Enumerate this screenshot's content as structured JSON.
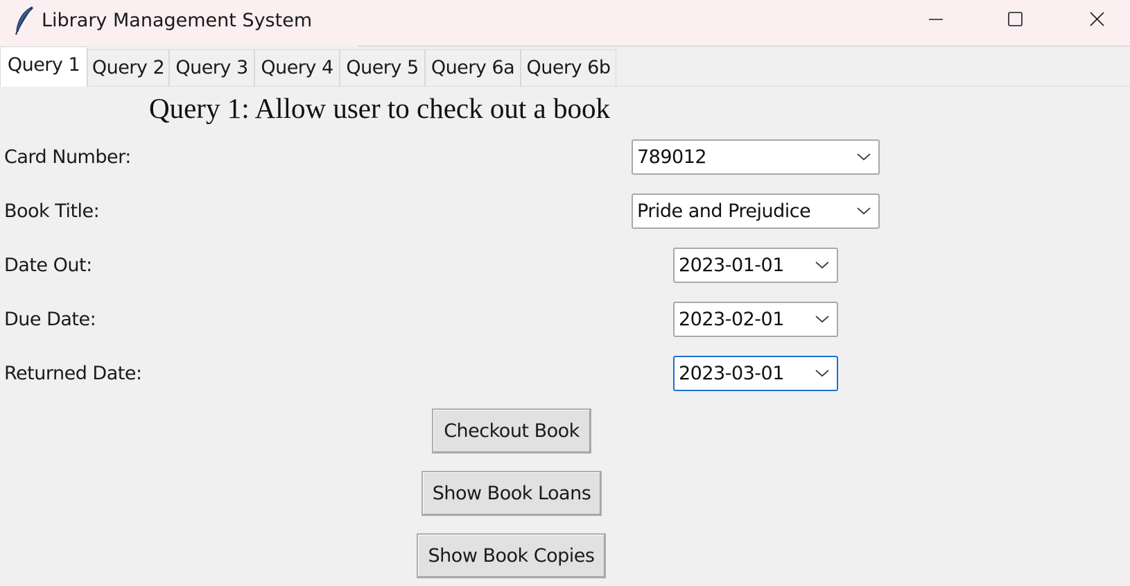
{
  "window": {
    "title": "Library Management System",
    "icon": "feather-icon",
    "controls": [
      "minimize-icon",
      "maximize-icon",
      "close-icon"
    ]
  },
  "tabs": [
    {
      "label": "Query 1",
      "active": true
    },
    {
      "label": "Query 2",
      "active": false
    },
    {
      "label": "Query 3",
      "active": false
    },
    {
      "label": "Query 4",
      "active": false
    },
    {
      "label": "Query 5",
      "active": false
    },
    {
      "label": "Query 6a",
      "active": false
    },
    {
      "label": "Query 6b",
      "active": false
    }
  ],
  "form": {
    "title": "Query 1: Allow user to check out a book",
    "fields": [
      {
        "label": "Card Number:",
        "value": "789012"
      },
      {
        "label": "Book Title:",
        "value": "Pride and Prejudice"
      },
      {
        "label": "Date Out:",
        "value": "2023-01-01"
      },
      {
        "label": "Due Date:",
        "value": "2023-02-01"
      },
      {
        "label": "Returned Date:",
        "value": "2023-03-01",
        "focused": true
      }
    ],
    "buttons": [
      {
        "label": "Checkout Book"
      },
      {
        "label": "Show Book Loans"
      },
      {
        "label": "Show Book Copies"
      }
    ]
  },
  "colors": {
    "titlebar_bg": "#fbeff1",
    "window_bg": "#f0f0f0",
    "focus_border": "#1f6fd0",
    "button_bg": "#e1e1e1"
  }
}
